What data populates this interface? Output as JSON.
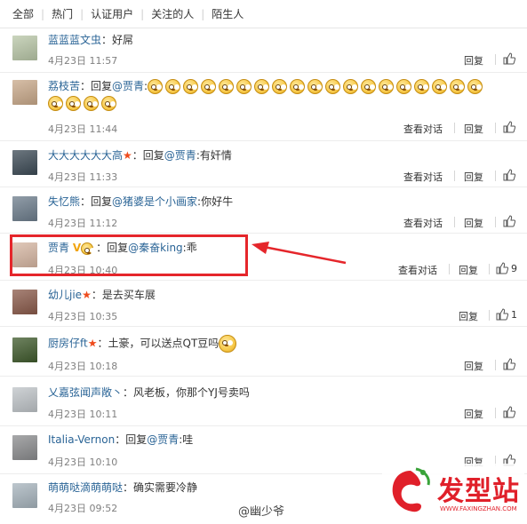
{
  "tabs": [
    "全部",
    "热门",
    "认证用户",
    "关注的人",
    "陌生人"
  ],
  "colors": {
    "link": "#2a6496",
    "highlight": "#e5262b",
    "star": "#ee4b1d",
    "brand": "#e0202a"
  },
  "actions": {
    "reply": "回复",
    "view_conversation": "查看对话"
  },
  "comments": [
    {
      "name": "蓝蓝蓝文虫",
      "text": "：好屌",
      "time": "4月23日 11:57"
    },
    {
      "name": "荔枝苦",
      "text": "：回复",
      "mention": "@贾青",
      "text2": ":",
      "time": "4月23日 11:44",
      "emoji_count": 23
    },
    {
      "name": "大大大大大大高",
      "text": "：回复",
      "mention": "@贾青",
      "text2": ":有奸情",
      "time": "4月23日 11:33"
    },
    {
      "name": "失忆熊",
      "text": "：回复",
      "mention": "@猪婆是个小画家",
      "text2": ":你好牛",
      "time": "4月23日 11:12"
    },
    {
      "name": "贾青",
      "text": "：回复",
      "mention": "@秦奋king",
      "text2": ":乖",
      "time": "4月23日 10:40",
      "likes": "9"
    },
    {
      "name": "幼儿jie",
      "text": "：是去买车展",
      "time": "4月23日 10:35",
      "likes": "1"
    },
    {
      "name": "厨房仔ft",
      "text": "：土豪，可以送点QT豆吗",
      "time": "4月23日 10:18"
    },
    {
      "name": "乂嘉弦闻声敞丶",
      "text": "：风老板，你那个YJ号卖吗",
      "time": "4月23日 10:11"
    },
    {
      "name": "Italia-Vernon",
      "text": "：回复",
      "mention": "@贾青",
      "text2": ":哇",
      "time": "4月23日 10:10"
    },
    {
      "name": "萌萌哒滴萌萌哒",
      "text": "：确实需要冷静",
      "time": "4月23日 09:52"
    }
  ],
  "watermark": {
    "weibo": "@幽少爷",
    "brand_name": "发型站",
    "brand_url": "WWW.FAXINGZHAN.COM"
  }
}
